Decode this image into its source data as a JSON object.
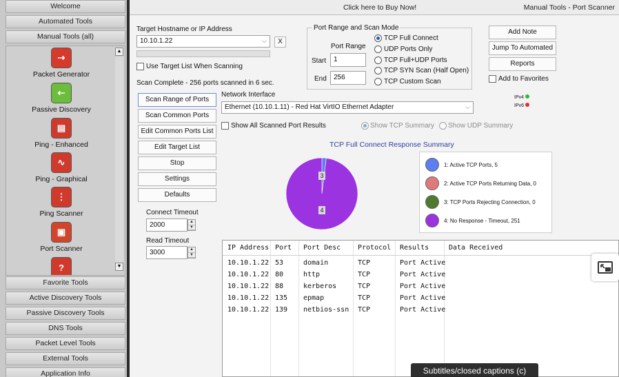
{
  "sidebar": {
    "categories_top": [
      "Welcome",
      "Automated Tools",
      "Manual Tools (all)"
    ],
    "tools": [
      {
        "label": "Packet Generator",
        "icon": "packet-generator-icon",
        "color": "#d63a2b"
      },
      {
        "label": "Passive Discovery",
        "icon": "passive-discovery-icon",
        "color": "#6dbd3c"
      },
      {
        "label": "Ping - Enhanced",
        "icon": "ping-enhanced-icon",
        "color": "#cf3a2d"
      },
      {
        "label": "Ping - Graphical",
        "icon": "ping-graphical-icon",
        "color": "#cf3a2d"
      },
      {
        "label": "Ping Scanner",
        "icon": "ping-scanner-icon",
        "color": "#cf3a2d"
      },
      {
        "label": "Port Scanner",
        "icon": "port-scanner-icon",
        "color": "#d2452d"
      },
      {
        "label": "",
        "icon": "partial-tool-icon",
        "color": "#cf3a2d"
      }
    ],
    "categories_bottom": [
      "Favorite Tools",
      "Active Discovery Tools",
      "Passive Discovery Tools",
      "DNS Tools",
      "Packet Level Tools",
      "External Tools",
      "Application Info"
    ]
  },
  "topbar": {
    "buy_text": "Click here to Buy Now!",
    "window_title": "Manual Tools - Port Scanner"
  },
  "target": {
    "label": "Target Hostname or IP Address",
    "value": "10.10.1.22",
    "clear_label": "X",
    "use_list_label": "Use Target List When Scanning",
    "status": "Scan Complete - 256 ports scanned in 6 sec."
  },
  "port_range": {
    "group_label": "Port Range and Scan Mode",
    "range_label": "Port Range",
    "start_label": "Start",
    "start_value": "1",
    "end_label": "End",
    "end_value": "256",
    "modes": [
      {
        "label": "TCP Full Connect",
        "selected": true
      },
      {
        "label": "UDP Ports Only",
        "selected": false
      },
      {
        "label": "TCP Full+UDP Ports",
        "selected": false
      },
      {
        "label": "TCP SYN Scan (Half Open)",
        "selected": false
      },
      {
        "label": "TCP Custom Scan",
        "selected": false
      }
    ]
  },
  "right_buttons": {
    "add_note": "Add Note",
    "jump": "Jump To Automated",
    "reports": "Reports",
    "favorites": "Add to Favorites",
    "ipv4": "IPv4",
    "ipv6": "IPv6"
  },
  "actions": [
    "Scan Range of Ports",
    "Scan Common Ports",
    "Edit Common Ports List",
    "Edit Target List",
    "Stop",
    "Settings",
    "Defaults"
  ],
  "interface": {
    "label": "Network Interface",
    "value": "Ethernet (10.10.1.11) - Red Hat VirtIO Ethernet Adapter"
  },
  "options": {
    "show_all": "Show All Scanned Port Results",
    "tcp_summary": "Show TCP Summary",
    "udp_summary": "Show UDP Summary"
  },
  "timeouts": {
    "connect_label": "Connect Timeout",
    "connect_value": "2000",
    "read_label": "Read Timeout",
    "read_value": "3000"
  },
  "chart_data": {
    "type": "pie",
    "title": "TCP Full Connect Response Summary",
    "categories": [
      "1: Active TCP Ports, 5",
      "2: Active TCP Ports Returning Data, 0",
      "3: TCP Ports Rejecting Connection, 0",
      "4: No Response - Timeout, 251"
    ],
    "values": [
      5,
      0,
      0,
      251
    ],
    "colors": [
      "#5b7ff0",
      "#e07a7a",
      "#4f7a2d",
      "#9b33e0"
    ],
    "slice_labels": [
      "3",
      "4"
    ]
  },
  "table": {
    "headers": [
      "IP Address",
      "Port",
      "Port Desc",
      "Protocol",
      "Results",
      "Data Received"
    ],
    "rows": [
      [
        "10.10.1.22",
        "53",
        "domain",
        "TCP",
        "Port Active",
        ""
      ],
      [
        "10.10.1.22",
        "80",
        "http",
        "TCP",
        "Port Active",
        ""
      ],
      [
        "10.10.1.22",
        "88",
        "kerberos",
        "TCP",
        "Port Active",
        ""
      ],
      [
        "10.10.1.22",
        "135",
        "epmap",
        "TCP",
        "Port Active",
        ""
      ],
      [
        "10.10.1.22",
        "139",
        "netbios-ssn",
        "TCP",
        "Port Active",
        ""
      ]
    ]
  },
  "overlay": {
    "captions_tip": "Subtitles/closed captions (c)"
  }
}
